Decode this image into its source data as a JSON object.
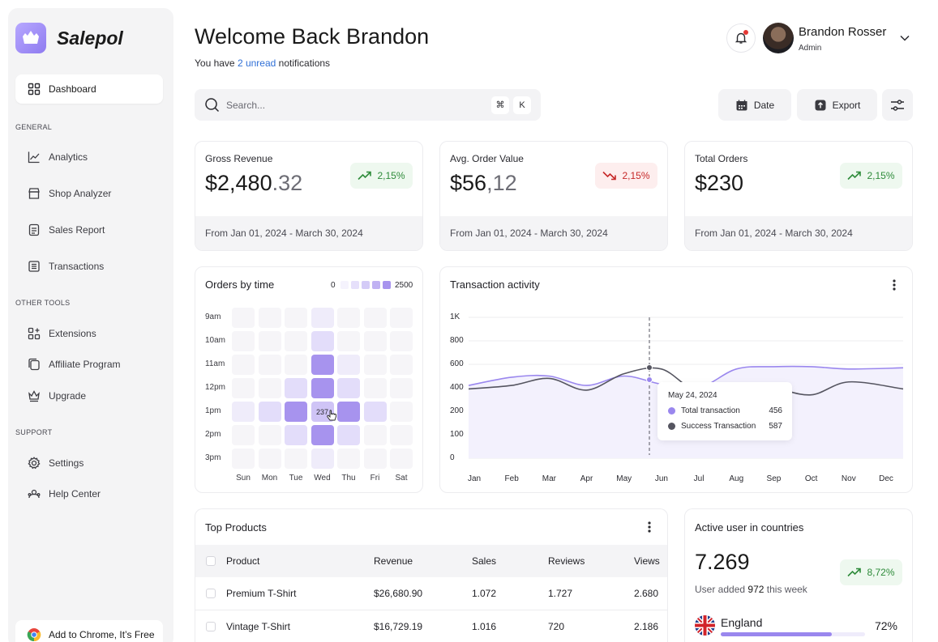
{
  "brand": {
    "name": "Salepol"
  },
  "sidebar": {
    "dashboard": "Dashboard",
    "sections": {
      "general": "GENERAL",
      "other_tools": "OTHER TOOLS",
      "support": "SUPPORT"
    },
    "general": [
      "Analytics",
      "Shop Analyzer",
      "Sales Report",
      "Transactions"
    ],
    "other_tools": [
      "Extensions",
      "Affiliate Program",
      "Upgrade"
    ],
    "support": [
      "Settings",
      "Help Center"
    ],
    "chrome": "Add to Chrome, It’s Free"
  },
  "header": {
    "welcome": "Welcome Back Brandon",
    "subtitle_prefix": "You have",
    "subtitle_link": "2 unread",
    "subtitle_suffix": "notifications",
    "user_name": "Brandon Rosser",
    "user_role": "Admin"
  },
  "search": {
    "placeholder": "Search...",
    "kbd1": "⌘",
    "kbd2": "K"
  },
  "toolbar": {
    "date": "Date",
    "export": "Export"
  },
  "stats": [
    {
      "label": "Gross Revenue",
      "value_main": "$2,480",
      "value_dec": ".32",
      "change": "2,15%",
      "trend": "up",
      "period": "From Jan 01, 2024 - March 30, 2024"
    },
    {
      "label": "Avg. Order Value",
      "value_main": "$56",
      "value_dec": ",12",
      "change": "2,15%",
      "trend": "down",
      "period": "From Jan 01, 2024 - March 30, 2024"
    },
    {
      "label": "Total Orders",
      "value_main": "$230",
      "value_dec": "",
      "change": "2,15%",
      "trend": "up",
      "period": "From Jan 01, 2024 - March 30, 2024"
    }
  ],
  "orders_by_time": {
    "title": "Orders by time",
    "legend_min": "0",
    "legend_max": "2500",
    "hovered_value": "237",
    "rows": [
      "9am",
      "10am",
      "11am",
      "12pm",
      "1pm",
      "2pm",
      "3pm"
    ],
    "cols": [
      "Sun",
      "Mon",
      "Tue",
      "Wed",
      "Thu",
      "Fri",
      "Sat"
    ],
    "levels": [
      [
        0,
        0,
        0,
        1,
        0,
        0,
        0
      ],
      [
        0,
        0,
        0,
        2,
        0,
        0,
        0
      ],
      [
        0,
        0,
        0,
        4,
        1,
        0,
        0
      ],
      [
        0,
        0,
        2,
        4,
        2,
        0,
        0
      ],
      [
        1,
        2,
        4,
        3,
        4,
        2,
        0
      ],
      [
        0,
        0,
        2,
        4,
        2,
        0,
        0
      ],
      [
        0,
        0,
        0,
        1,
        0,
        0,
        0
      ]
    ]
  },
  "transaction_activity": {
    "title": "Transaction activity",
    "tooltip": {
      "date": "May 24, 2024",
      "total_label": "Total transaction",
      "total_value": "456",
      "success_label": "Success Transaction",
      "success_value": "587"
    }
  },
  "chart_data": {
    "type": "line",
    "title": "Transaction activity",
    "x": [
      "Jan",
      "Feb",
      "Mar",
      "Apr",
      "May",
      "Jun",
      "Jul",
      "Aug",
      "Sep",
      "Oct",
      "Nov",
      "Dec"
    ],
    "ylim": [
      0,
      1000
    ],
    "yticks": [
      "1K",
      "800",
      "600",
      "400",
      "200",
      "100",
      "0"
    ],
    "grid": true,
    "series": [
      {
        "name": "Total transaction",
        "color": "#9a87ee",
        "values": [
          420,
          490,
          500,
          420,
          500,
          430,
          400,
          560,
          580,
          580,
          560,
          570
        ]
      },
      {
        "name": "Success Transaction",
        "color": "#555560",
        "values": [
          390,
          420,
          480,
          380,
          520,
          560,
          360,
          440,
          400,
          340,
          450,
          390
        ]
      }
    ]
  },
  "top_products": {
    "title": "Top Products",
    "columns": [
      "Product",
      "Revenue",
      "Sales",
      "Reviews",
      "Views"
    ],
    "rows": [
      [
        "Premium T-Shirt",
        "$26,680.90",
        "1.072",
        "1.727",
        "2.680"
      ],
      [
        "Vintage T-Shirt",
        "$16,729.19",
        "1.016",
        "720",
        "2.186"
      ]
    ]
  },
  "active_users": {
    "title": "Active user in countries",
    "value": "7.269",
    "sub_prefix": "User added",
    "sub_count": "972",
    "sub_suffix": "this week",
    "change": "8,72%",
    "country": "England",
    "country_pct": "72%",
    "country_fraction": 0.72
  },
  "colors": {
    "accent": "#9a87ee",
    "up": "#2e8b3a",
    "down": "#c62828",
    "link": "#2f6fd6"
  }
}
